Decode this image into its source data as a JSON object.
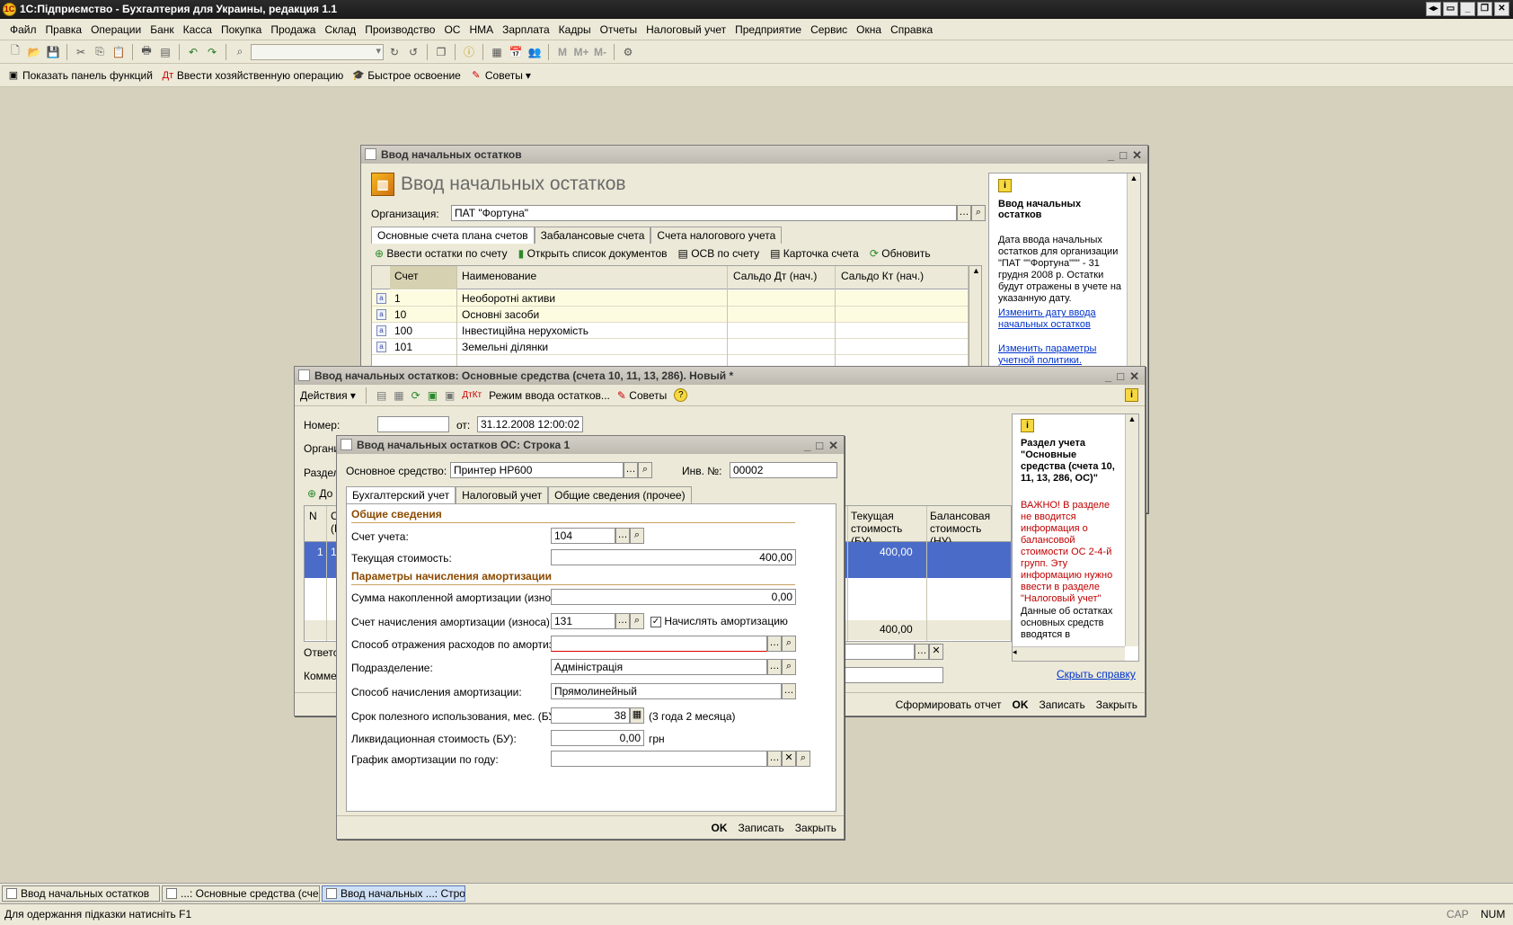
{
  "app": {
    "title": "1С:Підприємство - Бухгалтерия для Украины, редакция 1.1",
    "menu": [
      "Файл",
      "Правка",
      "Операции",
      "Банк",
      "Касса",
      "Покупка",
      "Продажа",
      "Склад",
      "Производство",
      "ОС",
      "НМА",
      "Зарплата",
      "Кадры",
      "Отчеты",
      "Налоговый учет",
      "Предприятие",
      "Сервис",
      "Окна",
      "Справка"
    ],
    "toolbar2": {
      "show_panel": "Показать панель функций",
      "enter_operation": "Ввести хозяйственную операцию",
      "quick_learn": "Быстрое освоение",
      "tips": "Советы"
    }
  },
  "win1": {
    "title": "Ввод начальных остатков",
    "heading": "Ввод начальных остатков",
    "org_label": "Организация:",
    "org_value": "ПАТ \"Фортуна\"",
    "tabs": [
      "Основные счета плана счетов",
      "Забалансовые счета",
      "Счета налогового учета"
    ],
    "actions": {
      "enter": "Ввести остатки по счету",
      "open_list": "Открыть список документов",
      "osv": "ОСВ по счету",
      "card": "Карточка счета",
      "refresh": "Обновить"
    },
    "columns": [
      "Счет",
      "Наименование",
      "Сальдо Дт (нач.)",
      "Сальдо Кт (нач.)"
    ],
    "rows": [
      {
        "account": "1",
        "name": "Необоротні активи"
      },
      {
        "account": "10",
        "name": "Основні засоби"
      },
      {
        "account": "100",
        "name": "Інвестиційна нерухомість"
      },
      {
        "account": "101",
        "name": "Земельні ділянки"
      }
    ],
    "help": {
      "title": "Ввод начальных остатков",
      "text": "Дата ввода начальных остатков для организации \"ПАТ \"\"Фортуна\"\"\" - 31 грудня 2008 р. Остатки будут отражены в учете на указанную дату.",
      "link1": "Изменить дату ввода начальных остатков",
      "link2": "Изменить параметры учетной политики."
    }
  },
  "win2": {
    "title": "Ввод начальных остатков: Основные средства (счета 10, 11, 13, 286). Новый *",
    "actions_label": "Действия",
    "mode_label": "Режим ввода остатков...",
    "tips_label": "Советы",
    "number_label": "Номер:",
    "number_value": "",
    "date_label": "от:",
    "date_value": "31.12.2008 12:00:02",
    "org_label_partial": "Органи",
    "section_label_partial": "Раздел",
    "add_label_partial": "До",
    "col_n": "N",
    "col_c_partial": "С",
    "col_c_partial2": "(Е",
    "col_cur_cost": "Текущая стоимость (БУ)",
    "col_bal_cost": "Балансовая стоимость (НУ)",
    "row_n": "1",
    "row_c": "1",
    "row_cur": "400,00",
    "total_cur": "400,00",
    "resp_partial": "Ответс",
    "comment_partial": "Комме",
    "btn_report": "Сформировать отчет",
    "btn_ok": "OK",
    "btn_save": "Записать",
    "btn_close": "Закрыть",
    "help": {
      "title": "Раздел учета \"Основные средства (счета 10, 11, 13, 286, ОС)\"",
      "warning": "ВАЖНО! В разделе не вводится информация о балансовой стоимости ОС 2-4-й групп. Эту информацию нужно ввести в разделе \"Налоговый учет\"",
      "text": "Данные об остатках основных средств вводятся в",
      "hide_link": "Скрыть справку"
    }
  },
  "win3": {
    "title": "Ввод начальных остатков ОС: Строка 1",
    "asset_label": "Основное средство:",
    "asset_value": "Принтер HP600",
    "inv_label": "Инв. №:",
    "inv_value": "00002",
    "tabs": [
      "Бухгалтерский учет",
      "Налоговый учет",
      "Общие сведения (прочее)"
    ],
    "section1": "Общие сведения",
    "account_label": "Счет учета:",
    "account_value": "104",
    "cur_cost_label": "Текущая стоимость:",
    "cur_cost_value": "400,00",
    "section2": "Параметры начисления амортизации",
    "accum_label": "Сумма накопленной амортизации (износа):",
    "accum_value": "0,00",
    "amort_acc_label": "Счет начисления амортизации (износа):",
    "amort_acc_value": "131",
    "amort_check_label": "Начислять амортизацию",
    "expense_label": "Способ отражения расходов по амортизации:",
    "expense_value": "",
    "dept_label": "Подразделение:",
    "dept_value": "Адміністрація",
    "method_label": "Способ начисления амортизации:",
    "method_value": "Прямолинейный",
    "term_label": "Срок полезного использования, мес. (БУ):",
    "term_value": "38",
    "term_hint": "(3 года 2 месяца)",
    "liq_label": "Ликвидационная стоимость (БУ):",
    "liq_value": "0,00",
    "liq_unit": "грн",
    "schedule_label": "График амортизации по году:",
    "schedule_value": "",
    "btn_ok": "OK",
    "btn_save": "Записать",
    "btn_close": "Закрыть"
  },
  "taskbar": [
    "Ввод начальных остатков",
    "...: Основные средства (сче...",
    "Ввод начальных ...: Строка 1"
  ],
  "status": {
    "hint": "Для одержання підказки натисніть F1",
    "cap": "CAP",
    "num": "NUM"
  },
  "colors": {
    "selection": "#4a6cc8",
    "row_yellow": "#fdfbe0",
    "section_header": "#8b4a00"
  }
}
